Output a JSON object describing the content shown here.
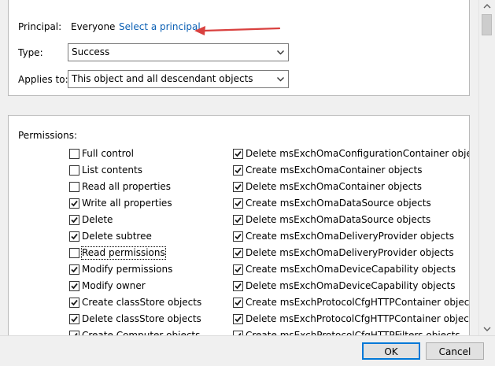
{
  "principal": {
    "label": "Principal:",
    "value": "Everyone",
    "link": "Select a principal"
  },
  "type_field": {
    "label": "Type:",
    "value": "Success"
  },
  "applies_field": {
    "label": "Applies to:",
    "value": "This object and all descendant objects"
  },
  "permissions": {
    "label": "Permissions:",
    "left": [
      {
        "text": "Full control",
        "checked": false
      },
      {
        "text": "List contents",
        "checked": false
      },
      {
        "text": "Read all properties",
        "checked": false
      },
      {
        "text": "Write all properties",
        "checked": true
      },
      {
        "text": "Delete",
        "checked": true
      },
      {
        "text": "Delete subtree",
        "checked": true
      },
      {
        "text": "Read permissions",
        "checked": false
      },
      {
        "text": "Modify permissions",
        "checked": true
      },
      {
        "text": "Modify owner",
        "checked": true
      },
      {
        "text": "Create classStore objects",
        "checked": true
      },
      {
        "text": "Delete classStore objects",
        "checked": true
      },
      {
        "text": "Create Computer objects",
        "checked": true
      }
    ],
    "right": [
      {
        "text": "Delete msExchOmaConfigurationContainer objects",
        "checked": true
      },
      {
        "text": "Create msExchOmaContainer objects",
        "checked": true
      },
      {
        "text": "Delete msExchOmaContainer objects",
        "checked": true
      },
      {
        "text": "Create msExchOmaDataSource objects",
        "checked": true
      },
      {
        "text": "Delete msExchOmaDataSource objects",
        "checked": true
      },
      {
        "text": "Create msExchOmaDeliveryProvider objects",
        "checked": true
      },
      {
        "text": "Delete msExchOmaDeliveryProvider objects",
        "checked": true
      },
      {
        "text": "Create msExchOmaDeviceCapability objects",
        "checked": true
      },
      {
        "text": "Delete msExchOmaDeviceCapability objects",
        "checked": true
      },
      {
        "text": "Create msExchProtocolCfgHTTPContainer objects",
        "checked": true
      },
      {
        "text": "Delete msExchProtocolCfgHTTPContainer objects",
        "checked": true
      },
      {
        "text": "Create msExchProtocolCfgHTTPFilters objects",
        "checked": true
      }
    ]
  },
  "buttons": {
    "ok": "OK",
    "cancel": "Cancel"
  },
  "colors": {
    "link": "#0a5fb4",
    "annotation_arrow": "#d9413f",
    "default_button_border": "#0078d7"
  },
  "icons": {
    "combo_arrow": "chevron-down-icon",
    "checkmark": "checkmark-icon",
    "annotation": "red-arrow-annotation"
  }
}
